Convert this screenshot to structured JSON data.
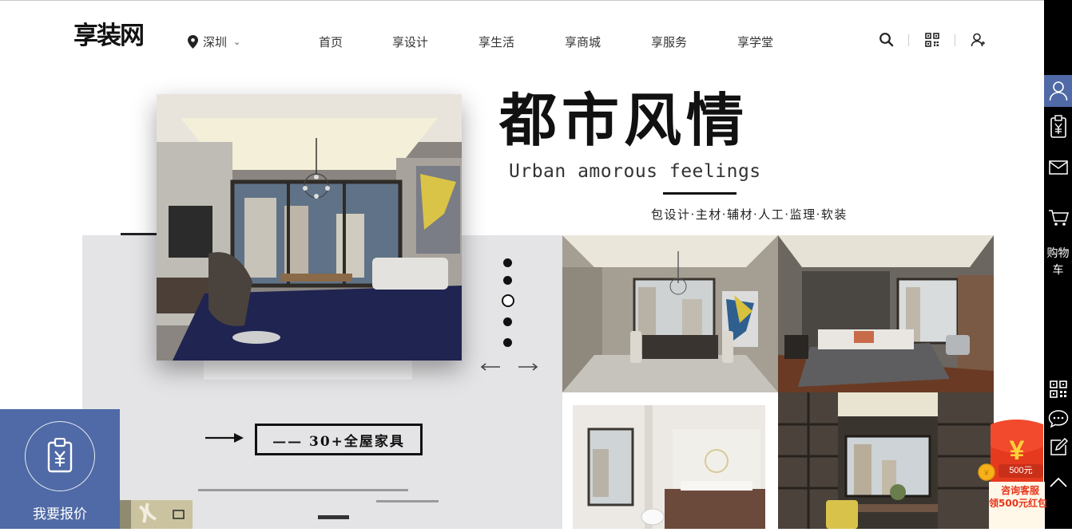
{
  "header": {
    "logo": "享装网",
    "city": "深圳",
    "nav": [
      "首页",
      "享设计",
      "享生活",
      "享商城",
      "享服务",
      "享学堂"
    ],
    "icons": [
      "search-icon",
      "qrcode-icon",
      "user-icon"
    ]
  },
  "hero": {
    "title_cn": "都市风情",
    "title_en": "Urban amorous feelings",
    "services": "包设计·主材·辅材·人工·监理·软装",
    "tag": "—— 30+全屋家具",
    "slide_dots": 5,
    "active_dot": 3
  },
  "quote_panel": {
    "icon": "clipboard-yuan-icon",
    "label": "我要报价"
  },
  "sidebar": {
    "items": [
      "user-icon",
      "clipboard-yuan-icon",
      "mail-icon",
      "cart-icon",
      "qrcode-icon",
      "chat-icon",
      "edit-icon",
      "back-to-top-icon"
    ],
    "cart_label": "购物车"
  },
  "red_packet": {
    "symbol": "¥",
    "amount": "500元",
    "line1": "咨询客服",
    "line2": "领500元红包"
  },
  "colors": {
    "accent": "#4f6aa6",
    "grey_block": "#e4e4e6",
    "red": "#e8351b",
    "sidebar": "#000000"
  }
}
